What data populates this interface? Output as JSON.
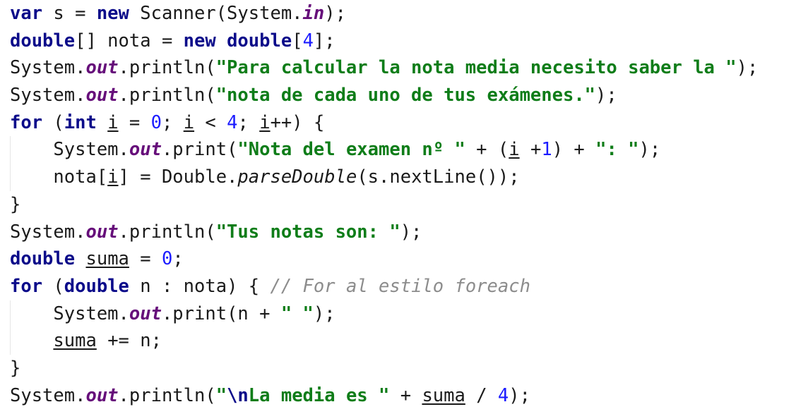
{
  "lines": [
    [
      {
        "t": "var",
        "k": "kw"
      },
      {
        "t": " s = ",
        "k": "pl"
      },
      {
        "t": "new",
        "k": "kw"
      },
      {
        "t": " Scanner(System.",
        "k": "pl"
      },
      {
        "t": "in",
        "k": "static"
      },
      {
        "t": ");",
        "k": "pl"
      }
    ],
    [
      {
        "t": "double",
        "k": "kw"
      },
      {
        "t": "[] nota = ",
        "k": "pl"
      },
      {
        "t": "new",
        "k": "kw"
      },
      {
        "t": " ",
        "k": "pl"
      },
      {
        "t": "double",
        "k": "kw"
      },
      {
        "t": "[",
        "k": "pl"
      },
      {
        "t": "4",
        "k": "num"
      },
      {
        "t": "];",
        "k": "pl"
      }
    ],
    [
      {
        "t": "System.",
        "k": "pl"
      },
      {
        "t": "out",
        "k": "static"
      },
      {
        "t": ".println(",
        "k": "pl"
      },
      {
        "t": "\"Para calcular la nota media necesito saber la \"",
        "k": "str"
      },
      {
        "t": ");",
        "k": "pl"
      }
    ],
    [
      {
        "t": "System.",
        "k": "pl"
      },
      {
        "t": "out",
        "k": "static"
      },
      {
        "t": ".println(",
        "k": "pl"
      },
      {
        "t": "\"nota de cada uno de tus exámenes.\"",
        "k": "str"
      },
      {
        "t": ");",
        "k": "pl"
      }
    ],
    [
      {
        "t": "for",
        "k": "kw"
      },
      {
        "t": " (",
        "k": "pl"
      },
      {
        "t": "int",
        "k": "kw"
      },
      {
        "t": " ",
        "k": "pl"
      },
      {
        "t": "i",
        "k": "uvar"
      },
      {
        "t": " = ",
        "k": "pl"
      },
      {
        "t": "0",
        "k": "num"
      },
      {
        "t": "; ",
        "k": "pl"
      },
      {
        "t": "i",
        "k": "uvar"
      },
      {
        "t": " < ",
        "k": "pl"
      },
      {
        "t": "4",
        "k": "num"
      },
      {
        "t": "; ",
        "k": "pl"
      },
      {
        "t": "i",
        "k": "uvar"
      },
      {
        "t": "++) {",
        "k": "pl"
      }
    ],
    [
      {
        "t": "    System.",
        "k": "pl"
      },
      {
        "t": "out",
        "k": "static"
      },
      {
        "t": ".print(",
        "k": "pl"
      },
      {
        "t": "\"Nota del examen nº \"",
        "k": "str"
      },
      {
        "t": " + (",
        "k": "pl"
      },
      {
        "t": "i",
        "k": "uvar"
      },
      {
        "t": " +",
        "k": "pl"
      },
      {
        "t": "1",
        "k": "num"
      },
      {
        "t": ") + ",
        "k": "pl"
      },
      {
        "t": "\": \"",
        "k": "str"
      },
      {
        "t": ");",
        "k": "pl"
      }
    ],
    [
      {
        "t": "    nota[",
        "k": "pl"
      },
      {
        "t": "i",
        "k": "uvar"
      },
      {
        "t": "] = Double.",
        "k": "pl"
      },
      {
        "t": "parseDouble",
        "k": "smeth"
      },
      {
        "t": "(s.nextLine());",
        "k": "pl"
      }
    ],
    [
      {
        "t": "}",
        "k": "pl"
      }
    ],
    [
      {
        "t": "System.",
        "k": "pl"
      },
      {
        "t": "out",
        "k": "static"
      },
      {
        "t": ".println(",
        "k": "pl"
      },
      {
        "t": "\"Tus notas son: \"",
        "k": "str"
      },
      {
        "t": ");",
        "k": "pl"
      }
    ],
    [
      {
        "t": "double",
        "k": "kw"
      },
      {
        "t": " ",
        "k": "pl"
      },
      {
        "t": "suma",
        "k": "uvar"
      },
      {
        "t": " = ",
        "k": "pl"
      },
      {
        "t": "0",
        "k": "num"
      },
      {
        "t": ";",
        "k": "pl"
      }
    ],
    [
      {
        "t": "for",
        "k": "kw"
      },
      {
        "t": " (",
        "k": "pl"
      },
      {
        "t": "double",
        "k": "kw"
      },
      {
        "t": " n : nota) { ",
        "k": "pl"
      },
      {
        "t": "// For al estilo foreach",
        "k": "cmt"
      }
    ],
    [
      {
        "t": "    System.",
        "k": "pl"
      },
      {
        "t": "out",
        "k": "static"
      },
      {
        "t": ".print(n + ",
        "k": "pl"
      },
      {
        "t": "\" \"",
        "k": "str"
      },
      {
        "t": ");",
        "k": "pl"
      }
    ],
    [
      {
        "t": "    ",
        "k": "pl"
      },
      {
        "t": "suma",
        "k": "uvar"
      },
      {
        "t": " += n;",
        "k": "pl"
      }
    ],
    [
      {
        "t": "}",
        "k": "pl"
      }
    ],
    [
      {
        "t": "System.",
        "k": "pl"
      },
      {
        "t": "out",
        "k": "static"
      },
      {
        "t": ".println(",
        "k": "pl"
      },
      {
        "t": "\"",
        "k": "str"
      },
      {
        "t": "\\n",
        "k": "esc"
      },
      {
        "t": "La media es \"",
        "k": "str"
      },
      {
        "t": " + ",
        "k": "pl"
      },
      {
        "t": "suma",
        "k": "uvar"
      },
      {
        "t": " / ",
        "k": "pl"
      },
      {
        "t": "4",
        "k": "num"
      },
      {
        "t": ");",
        "k": "pl"
      }
    ]
  ]
}
